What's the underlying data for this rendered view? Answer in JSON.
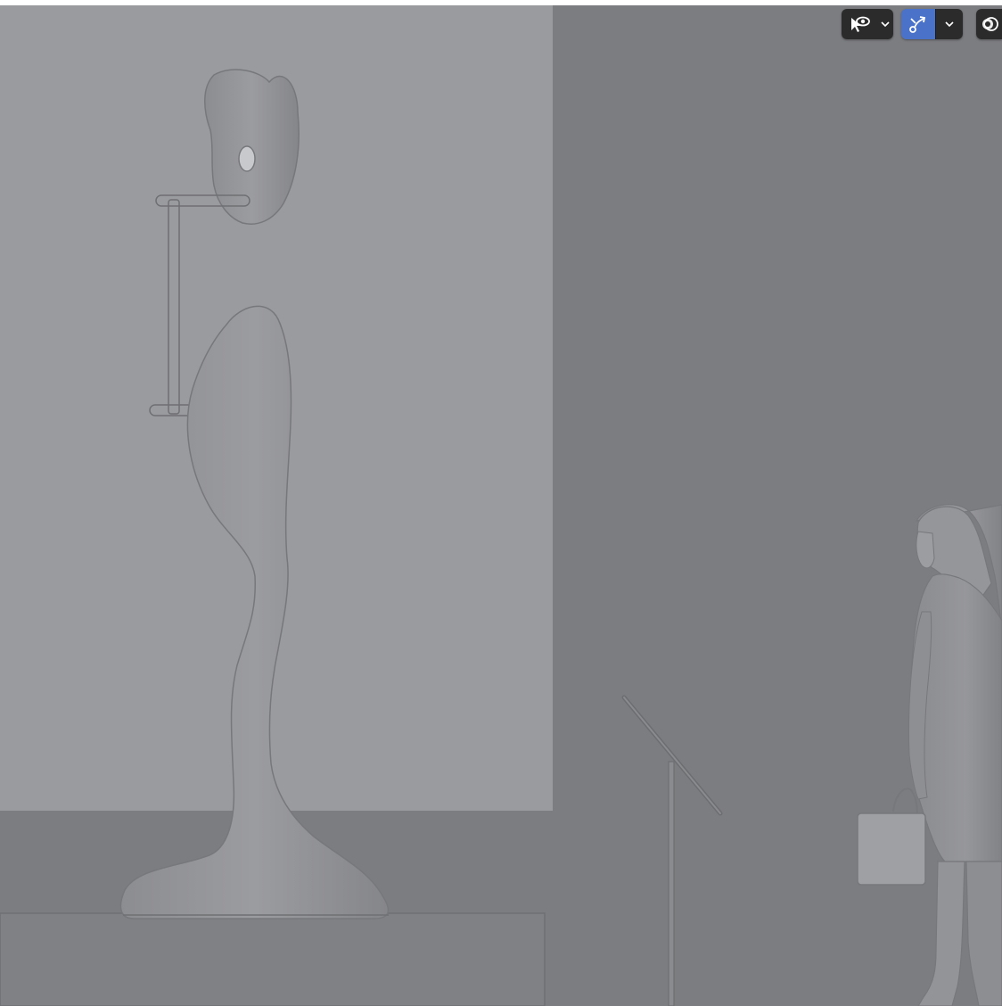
{
  "viewport": {
    "background_color": "#7c7d80",
    "wall_panel_color": "#9a9b9e",
    "pedestal_color": "#808184",
    "sculpture_color": "#8f9094"
  },
  "header": {
    "selectability_icon": "eye-pointer-icon",
    "selectability_dropdown_icon": "chevron-down-icon",
    "gizmo_toggle_icon": "gizmo-icon",
    "gizmo_toggle_state": "active",
    "gizmo_dropdown_icon": "chevron-down-icon",
    "overlay_icon": "overlay-circles-icon",
    "accent_color": "#4a72c9"
  }
}
